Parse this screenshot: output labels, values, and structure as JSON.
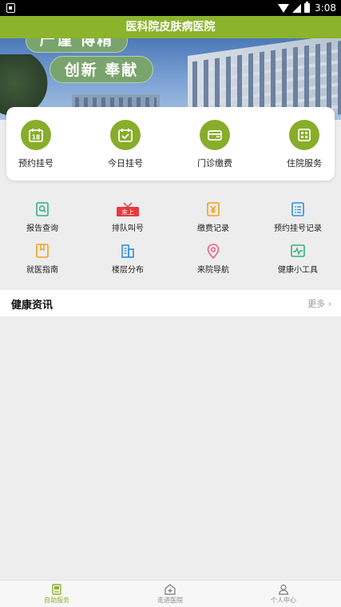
{
  "status_bar": {
    "time": "3:08"
  },
  "app": {
    "title": "医科院皮肤病医院"
  },
  "banner": {
    "slogan_line1": "严谨 博精",
    "slogan_line2": "创新 奉献"
  },
  "main_services": [
    {
      "label": "预约挂号",
      "icon": "calendar-18-icon",
      "calendar_day": "18"
    },
    {
      "label": "今日挂号",
      "icon": "calendar-check-icon"
    },
    {
      "label": "门诊缴费",
      "icon": "wallet-icon"
    },
    {
      "label": "住院服务",
      "icon": "building-icon"
    }
  ],
  "quick_services": [
    {
      "label": "报告查询",
      "icon": "report-search-icon"
    },
    {
      "label": "排队叫号",
      "icon": "queue-call-icon",
      "badge": "末上"
    },
    {
      "label": "缴费记录",
      "icon": "yen-receipt-icon"
    },
    {
      "label": "预约挂号记录",
      "icon": "list-record-icon"
    },
    {
      "label": "就医指南",
      "icon": "guide-book-icon"
    },
    {
      "label": "楼层分布",
      "icon": "floor-building-icon"
    },
    {
      "label": "来院导航",
      "icon": "location-pin-icon"
    },
    {
      "label": "健康小工具",
      "icon": "health-monitor-icon"
    }
  ],
  "news": {
    "title": "健康资讯",
    "more": "更多"
  },
  "tabbar": [
    {
      "label": "自助服务",
      "icon": "self-service-icon",
      "active": true
    },
    {
      "label": "走进医院",
      "icon": "hospital-icon",
      "active": false
    },
    {
      "label": "个人中心",
      "icon": "user-icon",
      "active": false
    }
  ],
  "colors": {
    "primary": "#8bb32c",
    "icon_green": "#88ad2a",
    "accent_red": "#e8383d",
    "accent_orange": "#f0a21d",
    "accent_blue": "#2e8fe0",
    "accent_pink": "#f0607e",
    "accent_teal": "#2fb37a"
  }
}
